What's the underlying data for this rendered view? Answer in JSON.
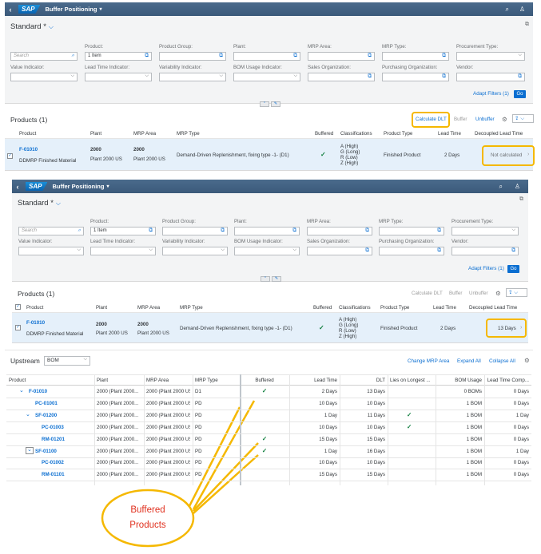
{
  "colors": {
    "shell": "#3f5f7f",
    "accent": "#0a6ed1",
    "highlight": "#f5b800",
    "check": "#107e3e"
  },
  "screen1": {
    "app_title": "Buffer Positioning",
    "logo": "SAP",
    "variant": "Standard *",
    "filters": {
      "search_placeholder": "Search",
      "product_label": "Product:",
      "product_value": "1 Item",
      "product_group_label": "Product Group:",
      "plant_label": "Plant:",
      "mrp_area_label": "MRP Area:",
      "mrp_type_label": "MRP Type:",
      "procurement_type_label": "Procurement Type:",
      "value_indicator_label": "Value Indicator:",
      "lead_time_indicator_label": "Lead Time Indicator:",
      "variability_indicator_label": "Variability Indicator:",
      "bom_usage_indicator_label": "BOM Usage Indicator:",
      "sales_org_label": "Sales Organization:",
      "purchasing_org_label": "Purchasing Organization:",
      "vendor_label": "Vendor:",
      "adapt_filters": "Adapt Filters (1)",
      "go": "Go"
    },
    "table": {
      "title": "Products (1)",
      "calculate_dlt": "Calculate DLT",
      "buffer": "Buffer",
      "unbuffer": "Unbuffer",
      "columns": [
        "Product",
        "Plant",
        "MRP Area",
        "MRP Type",
        "Buffered",
        "Classifications",
        "Product Type",
        "Lead Time",
        "Decoupled Lead Time"
      ],
      "row": {
        "product": "F-01010",
        "description": "DDMRP Finished Material",
        "plant": "2000",
        "plant_desc": "Plant 2000 US",
        "mrp_area": "2000",
        "mrp_area_desc": "Plant 2000 US",
        "mrp_type": "Demand-Driven Replenishment, fixing type -1- (D1)",
        "buffered": "✓",
        "class1": "A (High)",
        "class2": "G (Long)",
        "class3": "R (Low)",
        "class4": "Z (High)",
        "product_type": "Finished Product",
        "lead_time": "2 Days",
        "dlt": "Not calculated"
      }
    }
  },
  "screen2": {
    "app_title": "Buffer Positioning",
    "logo": "SAP",
    "variant": "Standard *",
    "filters": {
      "search_placeholder": "Search",
      "product_label": "Product:",
      "product_value": "1 Item",
      "product_group_label": "Product Group:",
      "plant_label": "Plant:",
      "mrp_area_label": "MRP Area:",
      "mrp_type_label": "MRP Type:",
      "procurement_type_label": "Procurement Type:",
      "value_indicator_label": "Value Indicator:",
      "lead_time_indicator_label": "Lead Time Indicator:",
      "variability_indicator_label": "Variability Indicator:",
      "bom_usage_indicator_label": "BOM Usage Indicator:",
      "sales_org_label": "Sales Organization:",
      "purchasing_org_label": "Purchasing Organization:",
      "vendor_label": "Vendor:",
      "adapt_filters": "Adapt Filters (1)",
      "go": "Go"
    },
    "table": {
      "title": "Products (1)",
      "calculate_dlt": "Calculate DLT",
      "buffer": "Buffer",
      "unbuffer": "Unbuffer",
      "columns": [
        "Product",
        "Plant",
        "MRP Area",
        "MRP Type",
        "Buffered",
        "Classifications",
        "Product Type",
        "Lead Time",
        "Decoupled Lead Time"
      ],
      "row": {
        "product": "F-01010",
        "description": "DDMRP Finished Material",
        "plant": "2000",
        "plant_desc": "Plant 2000 US",
        "mrp_area": "2000",
        "mrp_area_desc": "Plant 2000 US",
        "mrp_type": "Demand-Driven Replenishment, fixing type -1- (D1)",
        "buffered": "✓",
        "class1": "A (High)",
        "class2": "G (Long)",
        "class3": "R (Low)",
        "class4": "Z (High)",
        "product_type": "Finished Product",
        "lead_time": "2 Days",
        "dlt": "13 Days"
      }
    }
  },
  "upstream": {
    "title": "Upstream",
    "view_select": "BOM",
    "change_mrp_area": "Change MRP Area",
    "expand_all": "Expand All",
    "collapse_all": "Collapse All",
    "columns": [
      "Product",
      "Plant",
      "MRP Area",
      "MRP Type",
      "Buffered",
      "Lead Time",
      "DLT",
      "Lies on Longest ...",
      "BOM Usage",
      "Lead Time Comp..."
    ],
    "rows": [
      {
        "toggle": "⌄",
        "product": "F-01010",
        "plant": "2000 (Plant 2000...",
        "mrp_area": "2000 (Plant 2000 US",
        "mrp_type": "D1",
        "buffered": "✓",
        "lead_time": "2 Days",
        "dlt": "13 Days",
        "longest": "",
        "bom_usage": "0 BOMs",
        "comp": "0 Days"
      },
      {
        "toggle": "",
        "product": "PC-01001",
        "plant": "2000 (Plant 2000...",
        "mrp_area": "2000 (Plant 2000 US",
        "mrp_type": "PD",
        "buffered": "",
        "lead_time": "10 Days",
        "dlt": "10 Days",
        "longest": "",
        "bom_usage": "1 BOM",
        "comp": "0 Days"
      },
      {
        "toggle": "⌄",
        "product": "SF-01200",
        "plant": "2000 (Plant 2000...",
        "mrp_area": "2000 (Plant 2000 US",
        "mrp_type": "PD",
        "buffered": "",
        "lead_time": "1 Day",
        "dlt": "11 Days",
        "longest": "✓",
        "bom_usage": "1 BOM",
        "comp": "1 Day"
      },
      {
        "toggle": "",
        "product": "PC-01003",
        "plant": "2000 (Plant 2000...",
        "mrp_area": "2000 (Plant 2000 US",
        "mrp_type": "PD",
        "buffered": "",
        "lead_time": "10 Days",
        "dlt": "10 Days",
        "longest": "✓",
        "bom_usage": "1 BOM",
        "comp": "0 Days"
      },
      {
        "toggle": "",
        "product": "RM-01201",
        "plant": "2000 (Plant 2000...",
        "mrp_area": "2000 (Plant 2000 US",
        "mrp_type": "PD",
        "buffered": "✓",
        "lead_time": "15 Days",
        "dlt": "15 Days",
        "longest": "",
        "bom_usage": "1 BOM",
        "comp": "0 Days"
      },
      {
        "toggle": "⌄",
        "product": "SF-01100",
        "plant": "2000 (Plant 2000...",
        "mrp_area": "2000 (Plant 2000 US",
        "mrp_type": "PD",
        "buffered": "✓",
        "lead_time": "1 Day",
        "dlt": "16 Days",
        "longest": "",
        "bom_usage": "1 BOM",
        "comp": "1 Day"
      },
      {
        "toggle": "",
        "product": "PC-01002",
        "plant": "2000 (Plant 2000...",
        "mrp_area": "2000 (Plant 2000 US",
        "mrp_type": "PD",
        "buffered": "",
        "lead_time": "10 Days",
        "dlt": "10 Days",
        "longest": "",
        "bom_usage": "1 BOM",
        "comp": "0 Days"
      },
      {
        "toggle": "",
        "product": "RM-01101",
        "plant": "2000 (Plant 2000...",
        "mrp_area": "2000 (Plant 2000 US",
        "mrp_type": "PD",
        "buffered": "",
        "lead_time": "15 Days",
        "dlt": "15 Days",
        "longest": "",
        "bom_usage": "1 BOM",
        "comp": "0 Days"
      }
    ]
  },
  "callout": {
    "line1": "Buffered",
    "line2": "Products"
  }
}
